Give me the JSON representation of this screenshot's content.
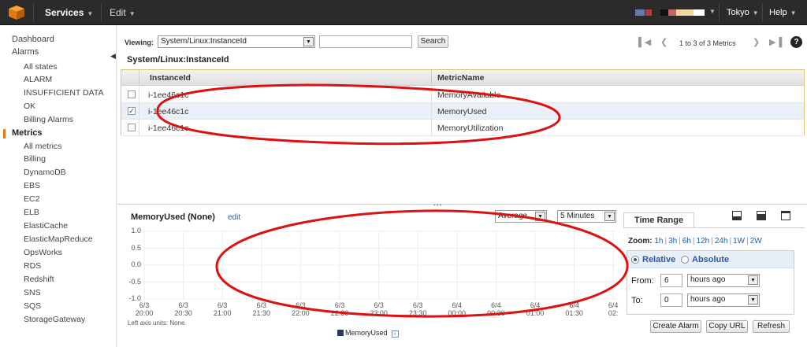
{
  "topbar": {
    "services": "Services",
    "edit": "Edit",
    "region": "Tokyo",
    "help": "Help"
  },
  "sidebar": {
    "items": [
      {
        "label": "Dashboard",
        "level": 0
      },
      {
        "label": "Alarms",
        "level": 0
      },
      {
        "label": "All states",
        "level": 1
      },
      {
        "label": "ALARM",
        "level": 1
      },
      {
        "label": "INSUFFICIENT DATA",
        "level": 1
      },
      {
        "label": "OK",
        "level": 1
      },
      {
        "label": "Billing Alarms",
        "level": 1
      },
      {
        "label": "Metrics",
        "level": 0,
        "active": true
      },
      {
        "label": "All metrics",
        "level": 1
      },
      {
        "label": "Billing",
        "level": 1
      },
      {
        "label": "DynamoDB",
        "level": 1
      },
      {
        "label": "EBS",
        "level": 1
      },
      {
        "label": "EC2",
        "level": 1
      },
      {
        "label": "ELB",
        "level": 1
      },
      {
        "label": "ElastiCache",
        "level": 1
      },
      {
        "label": "ElasticMapReduce",
        "level": 1
      },
      {
        "label": "OpsWorks",
        "level": 1
      },
      {
        "label": "RDS",
        "level": 1
      },
      {
        "label": "Redshift",
        "level": 1
      },
      {
        "label": "SNS",
        "level": 1
      },
      {
        "label": "SQS",
        "level": 1
      },
      {
        "label": "StorageGateway",
        "level": 1
      }
    ]
  },
  "filter": {
    "label": "Viewing:",
    "selected": "System/Linux:InstanceId",
    "search_value": "",
    "search_button": "Search",
    "pager_text": "1 to 3 of 3 Metrics"
  },
  "section_title": "System/Linux:InstanceId",
  "table": {
    "columns": [
      "InstanceId",
      "MetricName"
    ],
    "rows": [
      {
        "instance": "i-1ee46c1c",
        "metric": "MemoryAvailable",
        "checked": false
      },
      {
        "instance": "i-1ee46c1c",
        "metric": "MemoryUsed",
        "checked": true
      },
      {
        "instance": "i-1ee46c1c",
        "metric": "MemoryUtilization",
        "checked": false
      }
    ]
  },
  "graph": {
    "title": "MemoryUsed (None)",
    "edit": "edit",
    "statistic": "Average",
    "period": "5 Minutes",
    "axis_units": "Left axis units: None",
    "legend": "MemoryUsed",
    "y_ticks": [
      "1.0",
      "0.5",
      "0.0",
      "-0.5",
      "-1.0"
    ],
    "x_ticks": [
      [
        "6/3",
        "20:00"
      ],
      [
        "6/3",
        "20:30"
      ],
      [
        "6/3",
        "21:00"
      ],
      [
        "6/3",
        "21:30"
      ],
      [
        "6/3",
        "22:00"
      ],
      [
        "6/3",
        "22:30"
      ],
      [
        "6/3",
        "23:00"
      ],
      [
        "6/3",
        "23:30"
      ],
      [
        "6/4",
        "00:00"
      ],
      [
        "6/4",
        "00:30"
      ],
      [
        "6/4",
        "01:00"
      ],
      [
        "6/4",
        "01:30"
      ],
      [
        "6/4",
        "02:"
      ]
    ]
  },
  "time_range": {
    "tab": "Time Range",
    "zoom_label": "Zoom:",
    "zoom_options": [
      "1h",
      "3h",
      "6h",
      "12h",
      "24h",
      "1W",
      "2W"
    ],
    "relative": "Relative",
    "absolute": "Absolute",
    "from_label": "From:",
    "from_value": "6",
    "from_unit": "hours ago",
    "to_label": "To:",
    "to_value": "0",
    "to_unit": "hours ago"
  },
  "actions": {
    "create_alarm": "Create Alarm",
    "copy_url": "Copy URL",
    "refresh": "Refresh"
  },
  "colors": {
    "topbar": "#2b2b2b",
    "accent": "#e47911",
    "link": "#1a5fa5",
    "annotation": "#dd1111"
  }
}
